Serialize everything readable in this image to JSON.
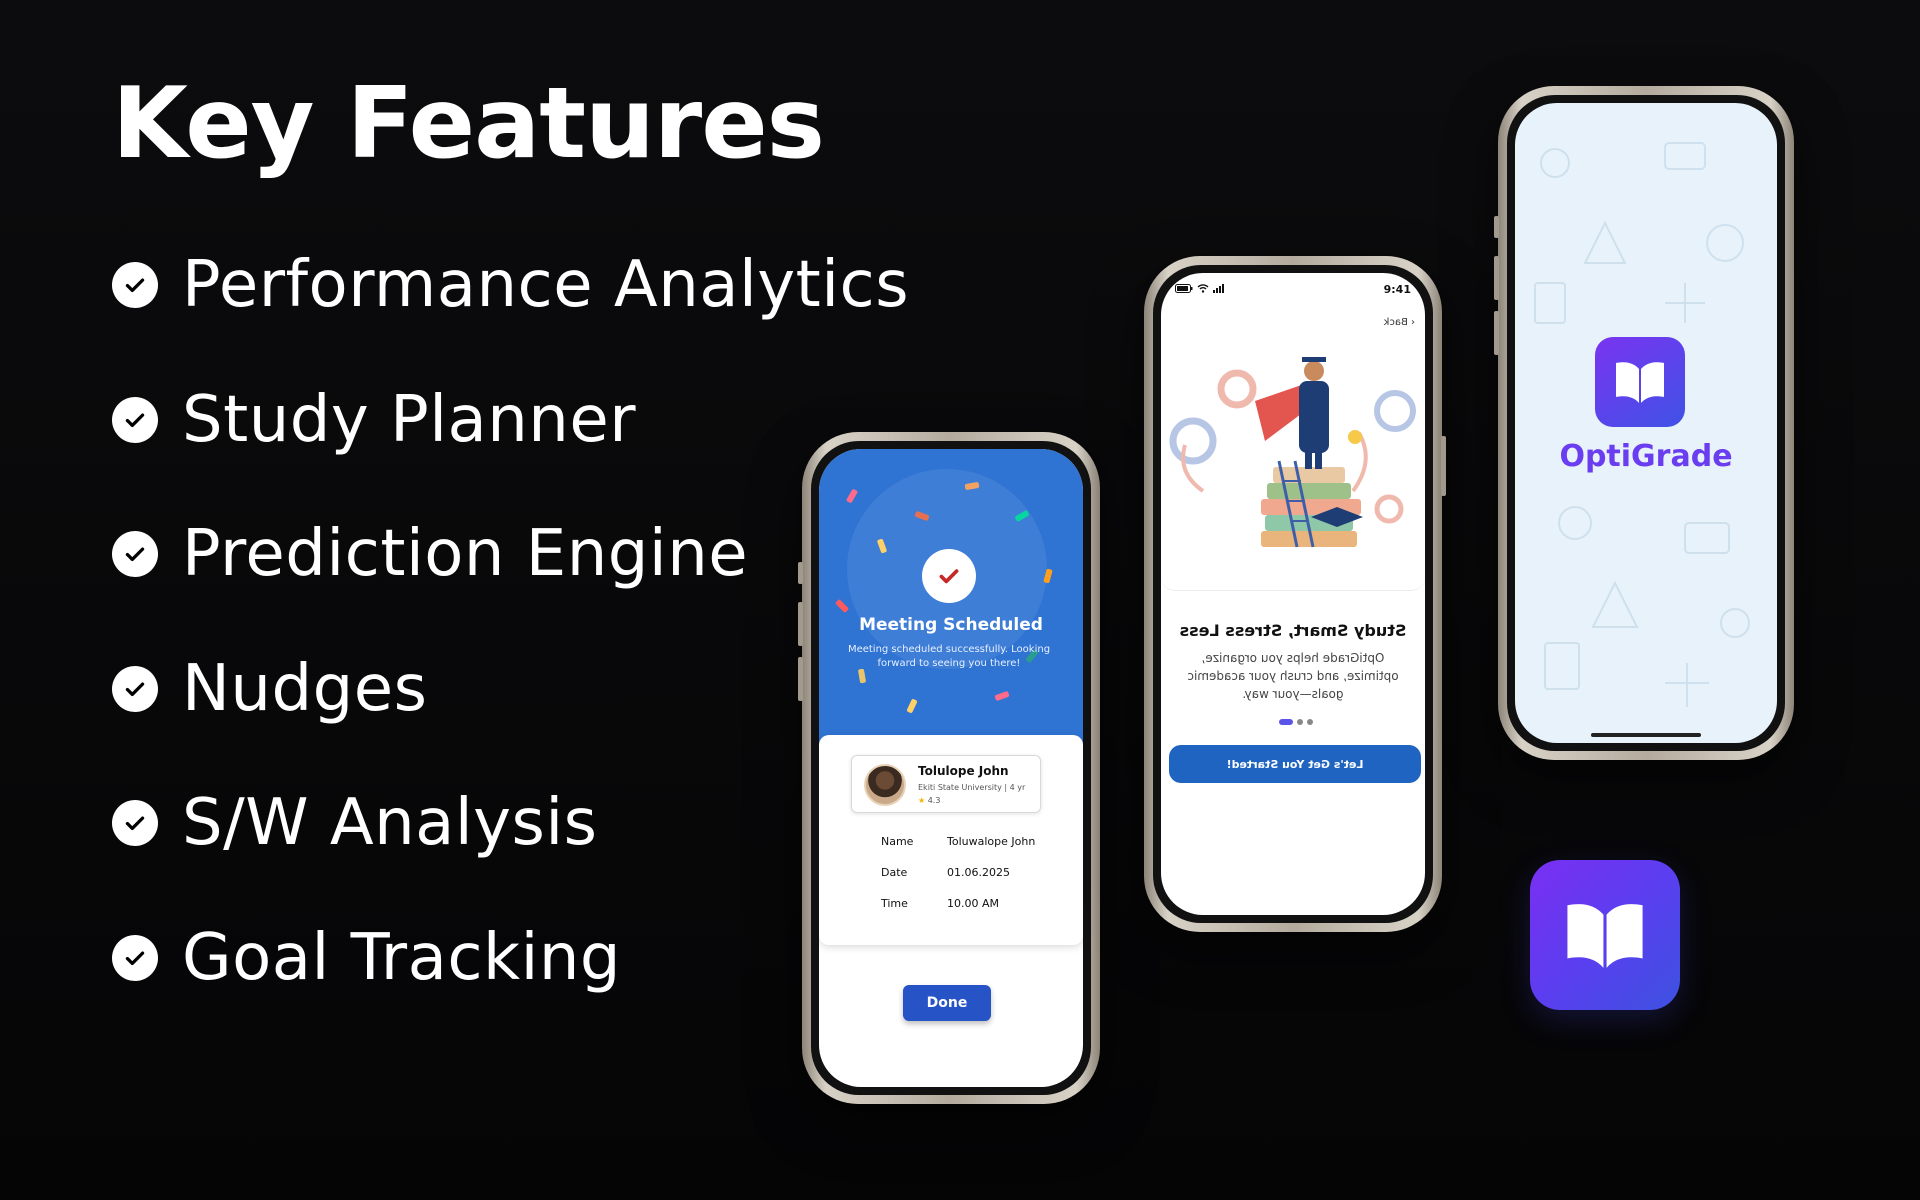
{
  "heading": "Key Features",
  "features": [
    {
      "label": "Performance Analytics"
    },
    {
      "label": "Study Planner"
    },
    {
      "label": "Prediction Engine"
    },
    {
      "label": "Nudges"
    },
    {
      "label": "S/W Analysis"
    },
    {
      "label": "Goal Tracking"
    }
  ],
  "phone_meeting": {
    "title": "Meeting Scheduled",
    "subtitle": "Meeting scheduled successfully. Looking forward to seeing you there!",
    "profile": {
      "name": "Tolulope John",
      "university": "Ekiti State University | 4 yr",
      "rating": "4.3"
    },
    "details": [
      {
        "key": "Name",
        "value": "Toluwalope John"
      },
      {
        "key": "Date",
        "value": "01.06.2025"
      },
      {
        "key": "Time",
        "value": "10.00 AM"
      }
    ],
    "done_label": "Done"
  },
  "phone_onboarding": {
    "time": "9:41",
    "back_label": "Back",
    "title": "Study Smart, Stress Less",
    "body": "OptiGrade helps you organize, optimize, and crush your academic goals—your way.",
    "cta_label": "Let's Get You Started!"
  },
  "phone_splash": {
    "brand": "OptiGrade"
  },
  "colors": {
    "background": "#060607",
    "meeting_blue": "#2f73d3",
    "button_blue": "#1e64c0",
    "brand_purple": "#6a3df0"
  },
  "icons": [
    "check-icon",
    "book-icon",
    "wifi-icon",
    "signal-icon",
    "battery-icon",
    "star-icon"
  ]
}
